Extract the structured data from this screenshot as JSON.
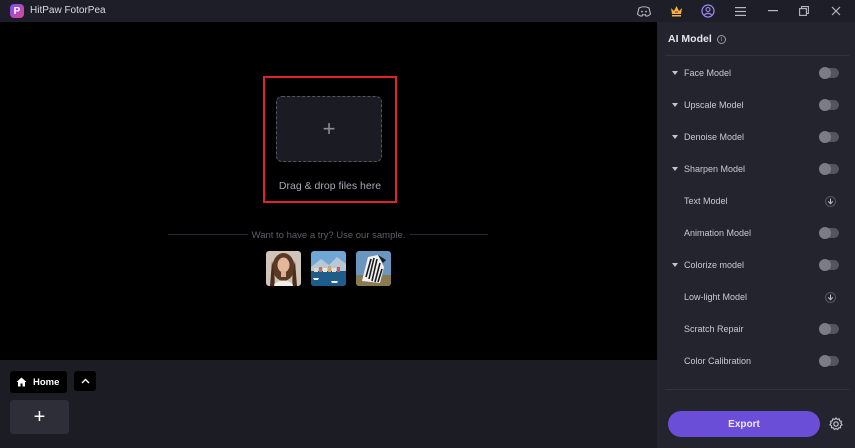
{
  "window": {
    "title": "HitPaw FotorPea",
    "logo_letter": "P"
  },
  "titlebar_icons": [
    "discord-icon",
    "crown-icon",
    "account-icon",
    "menu-icon",
    "minimize-icon",
    "restore-icon",
    "close-icon"
  ],
  "canvas": {
    "drop_label": "Drag & drop files here",
    "sample_prompt": "Want to have a try? Use our sample.",
    "samples": [
      "sample-portrait",
      "sample-coastal-town",
      "sample-zebra"
    ],
    "highlight_color": "#e0242b"
  },
  "bottombar": {
    "home_label": "Home"
  },
  "panel": {
    "title": "AI Model",
    "models": [
      {
        "label": "Face Model",
        "expandable": true,
        "control": "toggle"
      },
      {
        "label": "Upscale Model",
        "expandable": true,
        "control": "toggle"
      },
      {
        "label": "Denoise Model",
        "expandable": true,
        "control": "toggle"
      },
      {
        "label": "Sharpen Model",
        "expandable": true,
        "control": "toggle"
      },
      {
        "label": "Text Model",
        "expandable": false,
        "control": "download"
      },
      {
        "label": "Animation Model",
        "expandable": false,
        "control": "toggle"
      },
      {
        "label": "Colorize model",
        "expandable": true,
        "control": "toggle"
      },
      {
        "label": "Low-light Model",
        "expandable": false,
        "control": "download"
      },
      {
        "label": "Scratch Repair",
        "expandable": false,
        "control": "toggle"
      },
      {
        "label": "Color Calibration",
        "expandable": false,
        "control": "toggle"
      }
    ],
    "export_label": "Export",
    "accent_color": "#6a4ed8"
  }
}
